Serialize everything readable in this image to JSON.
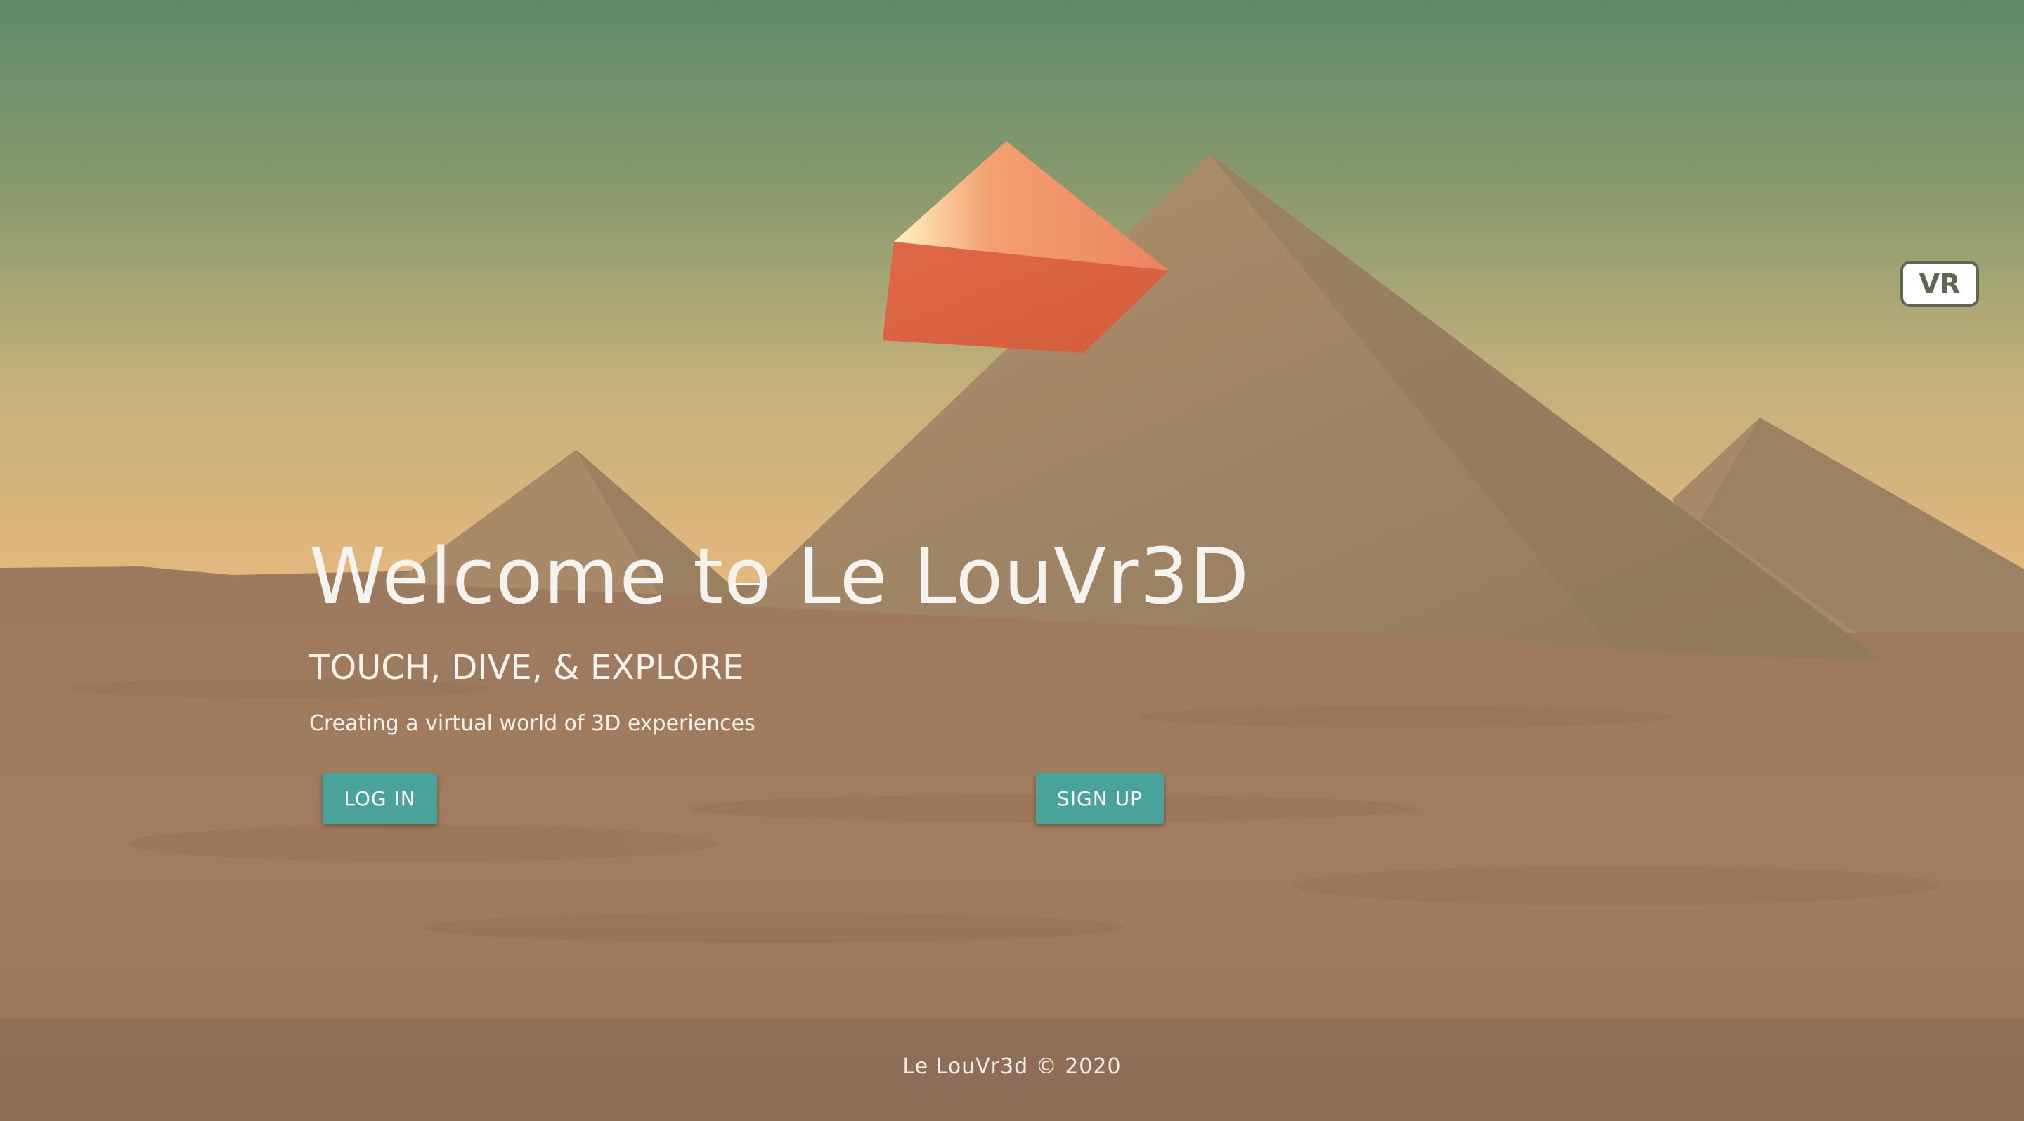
{
  "hero": {
    "title": "Welcome to Le LouVr3D",
    "subtitle": "TOUCH, DIVE, & EXPLORE",
    "tagline": "Creating a virtual world of 3D experiences"
  },
  "actions": {
    "login_label": "LOG IN",
    "signup_label": "SIGN UP"
  },
  "vr": {
    "label": "VR"
  },
  "footer": {
    "text": "Le LouVr3d © 2020"
  },
  "colors": {
    "sky_top": "#62896a",
    "sky_horizon": "#e2b77d",
    "sand": "#a07b5e",
    "pyramid": "#a58769",
    "floating_box": "#d9603f",
    "button": "#4aa39b",
    "vr_border": "#5b6a4e"
  }
}
